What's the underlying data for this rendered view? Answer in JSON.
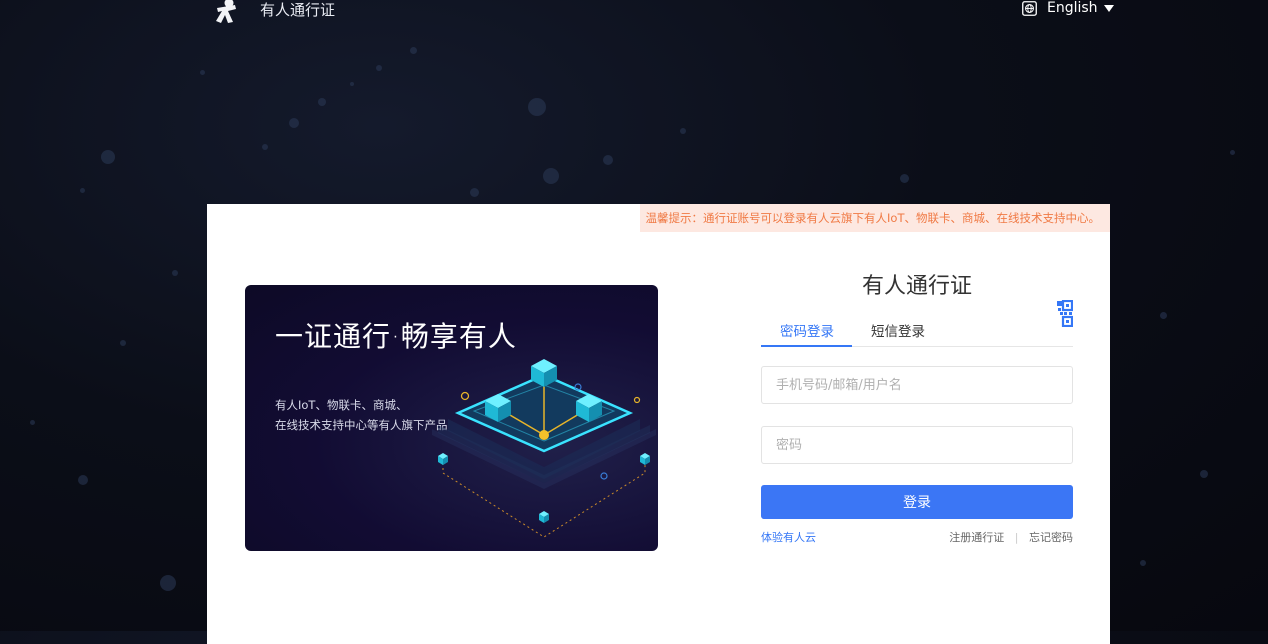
{
  "header": {
    "brand": "有人通行证",
    "language": "English"
  },
  "notice": "温馨提示：通行证账号可以登录有人云旗下有人IoT、物联卡、商城、在线技术支持中心。",
  "banner": {
    "title": "一证通行·畅享有人",
    "desc_line1": "有人IoT、物联卡、商城、",
    "desc_line2": "在线技术支持中心等有人旗下产品"
  },
  "form": {
    "title": "有人通行证",
    "tabs": [
      "密码登录",
      "短信登录"
    ],
    "username_placeholder": "手机号码/邮箱/用户名",
    "password_placeholder": "密码",
    "login_label": "登录",
    "trial_link": "体验有人云",
    "register_link": "注册通行证",
    "separator": "|",
    "forgot_link": "忘记密码"
  },
  "colors": {
    "accent": "#3b76f5",
    "notice_bg": "#fde8e1",
    "notice_text": "#f07a45",
    "page_bg": "#0b0e18"
  }
}
